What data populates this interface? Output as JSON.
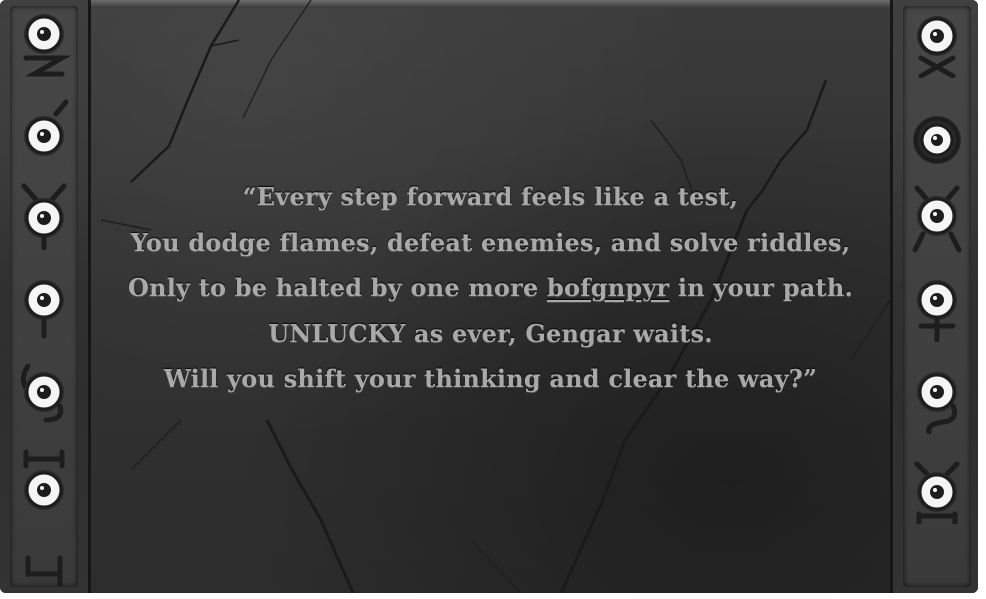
{
  "riddle": {
    "line1": "“Every step forward feels like a test,",
    "line2": "You dodge flames, defeat enemies, and solve riddles,",
    "line3_before": "Only to be halted by one more ",
    "line3_cipher": "bofgnpyr",
    "line3_after": " in your path.",
    "line4_emph": "UNLUCKY",
    "line4_rest": " as ever, Gengar waits.",
    "line5": "Will you shift your thinking and clear the way?”"
  },
  "left_glyphs": [
    "unown-z-icon",
    "unown-q-icon",
    "unown-y-icon",
    "unown-d-icon",
    "unown-g-icon",
    "unown-h-icon",
    "unown-y2-icon"
  ],
  "right_glyphs": [
    "unown-x-icon",
    "unown-o-icon",
    "unown-x2-icon",
    "unown-t-icon",
    "unown-g2-icon",
    "unown-a-icon"
  ],
  "colors": {
    "stone": "#333333",
    "text": "#a9a9a9",
    "eye_white": "#ffffff"
  }
}
